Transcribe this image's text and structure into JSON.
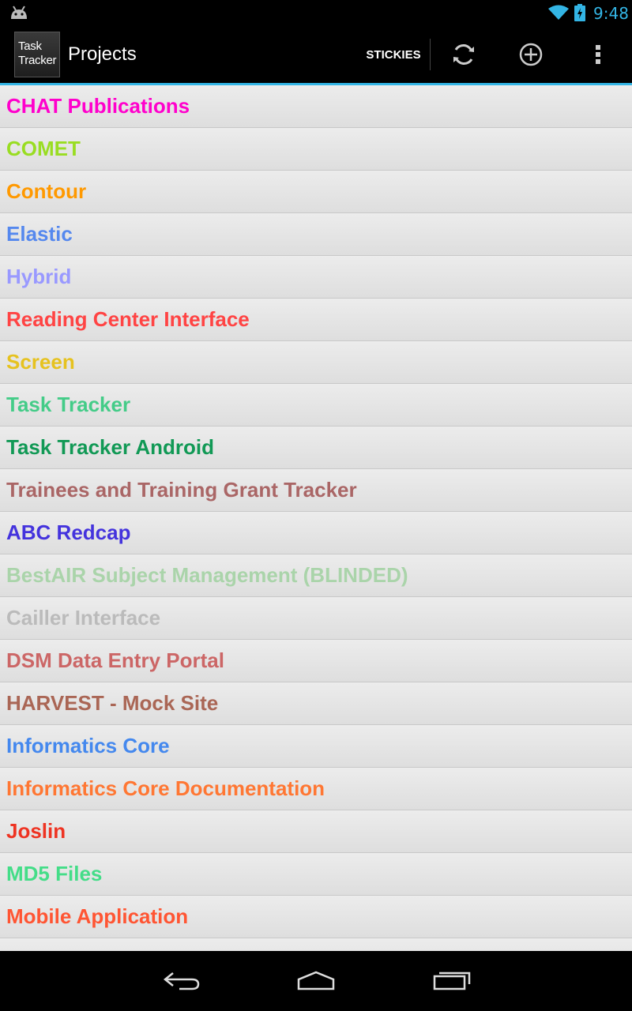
{
  "status_bar": {
    "time": "9:48",
    "icons": [
      "android-icon",
      "wifi-icon",
      "battery-icon"
    ],
    "clock_color": "#33b5e5"
  },
  "action_bar": {
    "logo_line1": "Task",
    "logo_line2": "Tracker",
    "title": "Projects",
    "stickies_label": "STICKIES",
    "icons": [
      "refresh-icon",
      "add-icon",
      "overflow-menu-icon"
    ],
    "accent_color": "#33b5e5"
  },
  "projects": [
    {
      "name": "CHAT Publications",
      "color": "#ff00cc"
    },
    {
      "name": "COMET",
      "color": "#99dd22"
    },
    {
      "name": "Contour",
      "color": "#ff9900"
    },
    {
      "name": "Elastic",
      "color": "#5588ee"
    },
    {
      "name": "Hybrid",
      "color": "#9999ff"
    },
    {
      "name": "Reading Center Interface",
      "color": "#ff4444"
    },
    {
      "name": "Screen",
      "color": "#e6c21f"
    },
    {
      "name": "Task Tracker",
      "color": "#44cc88"
    },
    {
      "name": "Task Tracker Android",
      "color": "#119955"
    },
    {
      "name": "Trainees and Training Grant Tracker",
      "color": "#aa6666"
    },
    {
      "name": "ABC Redcap",
      "color": "#4433dd"
    },
    {
      "name": "BestAIR Subject Management (BLINDED)",
      "color": "#aad4aa"
    },
    {
      "name": "Cailler Interface",
      "color": "#bbbbbb"
    },
    {
      "name": "DSM Data Entry Portal",
      "color": "#cc6666"
    },
    {
      "name": "HARVEST - Mock Site",
      "color": "#aa6655"
    },
    {
      "name": "Informatics Core",
      "color": "#4488ee"
    },
    {
      "name": "Informatics Core Documentation",
      "color": "#ff7733"
    },
    {
      "name": "Joslin",
      "color": "#ee3322"
    },
    {
      "name": "MD5 Files",
      "color": "#44dd88"
    },
    {
      "name": "Mobile Application",
      "color": "#ff5533"
    },
    {
      "name": "",
      "color": "#ff3333"
    }
  ],
  "nav_bar": {
    "icons": [
      "back-icon",
      "home-icon",
      "recents-icon"
    ]
  }
}
